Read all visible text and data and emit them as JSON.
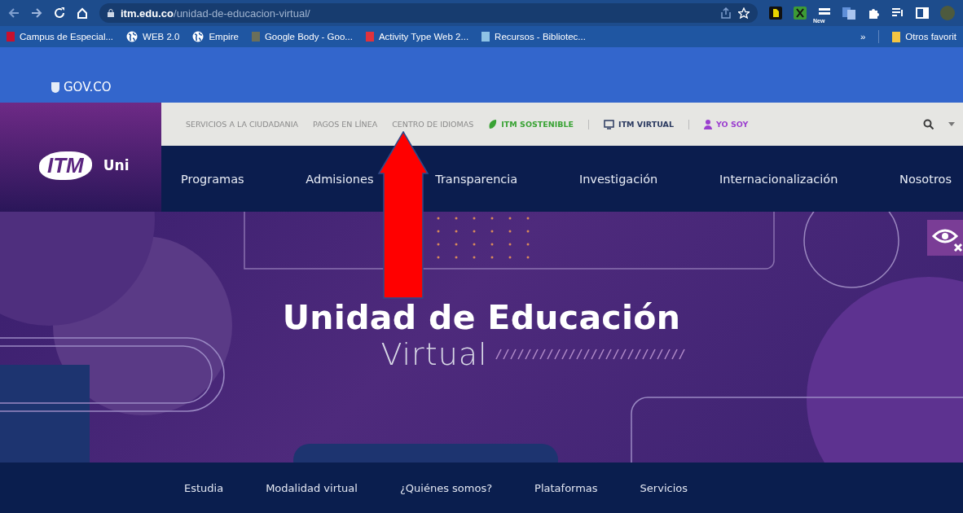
{
  "browser": {
    "address": {
      "host": "itm.edu.co",
      "path": "/unidad-de-educacion-virtual/"
    },
    "extension_badge": "New"
  },
  "bookmarks": [
    {
      "label": "Campus de Especial...",
      "kind": "square",
      "color": "#c8102e"
    },
    {
      "label": "WEB 2.0",
      "kind": "globe"
    },
    {
      "label": "Empire",
      "kind": "globe"
    },
    {
      "label": "Google Body - Goo...",
      "kind": "square",
      "color": "#6b6f5a"
    },
    {
      "label": "Activity Type Web 2...",
      "kind": "square",
      "color": "#e0323c"
    },
    {
      "label": "Recursos - Bibliotec...",
      "kind": "square",
      "color": "#8ec3e6"
    }
  ],
  "bookmarks_overflow": "»",
  "other_bookmarks": "Otros favorit",
  "gov_bar": {
    "label": "GOV.CO"
  },
  "header": {
    "logo": "ITM",
    "institution_name": "Uni",
    "utility_links": [
      {
        "label": "SERVICIOS A LA CIUDADANIA",
        "kind": "plain"
      },
      {
        "label": "PAGOS EN LÍNEA",
        "kind": "plain"
      },
      {
        "label": "CENTRO DE IDIOMAS",
        "kind": "plain"
      },
      {
        "label": "ITM SOSTENIBLE",
        "kind": "leaf"
      },
      {
        "label": "ITM VIRTUAL",
        "kind": "monitor"
      },
      {
        "label": "YO SOY",
        "kind": "user"
      }
    ],
    "main_nav": [
      "Programas",
      "Admisiones",
      "Transparencia",
      "Investigación",
      "Internacionalización",
      "Nosotros"
    ]
  },
  "hero": {
    "title": "Unidad de Educación",
    "subtitle": "Virtual"
  },
  "bottom_nav": [
    "Estudia",
    "Modalidad virtual",
    "¿Quiénes somos?",
    "Plataformas",
    "Servicios"
  ]
}
